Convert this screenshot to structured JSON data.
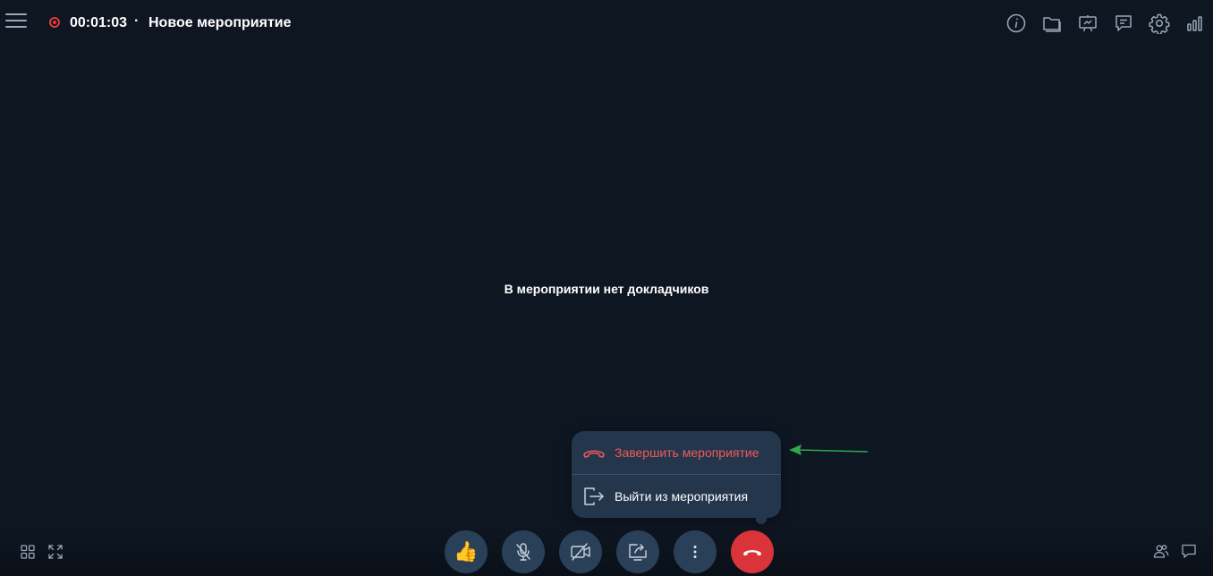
{
  "header": {
    "timer": "00:01:03",
    "separator": "·",
    "title": "Новое мероприятие"
  },
  "header_icons": [
    "info-icon",
    "folder-icon",
    "presentation-icon",
    "chat-icon",
    "gear-icon",
    "signal-bars-icon"
  ],
  "main": {
    "empty_message": "В мероприятии нет докладчиков"
  },
  "popup": {
    "end_event_label": "Завершить мероприятие",
    "leave_event_label": "Выйти из мероприятия"
  },
  "controls": {
    "reaction_emoji": "👍",
    "items": [
      "reaction-button",
      "microphone-button",
      "camera-button",
      "share-screen-button",
      "more-button",
      "hangup-button"
    ]
  },
  "colors": {
    "background": "#0e1622",
    "control_bg": "#2a4058",
    "popup_bg": "#24364c",
    "danger": "#f05a5a",
    "hangup": "#d8343a",
    "annotation_arrow": "#2fa84f"
  }
}
